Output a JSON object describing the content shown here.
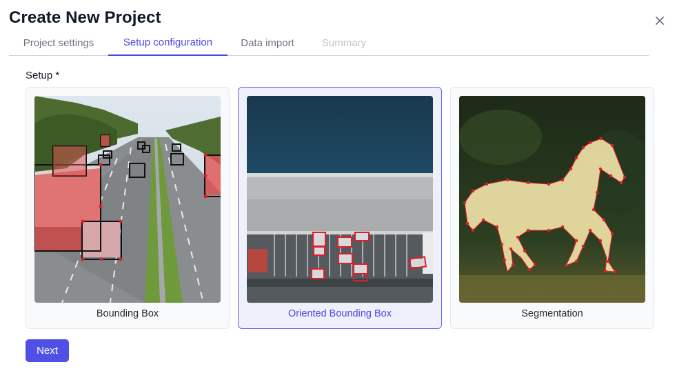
{
  "dialog": {
    "title": "Create New Project",
    "close_icon": "close-icon"
  },
  "tabs": [
    {
      "label": "Project settings",
      "state": "default"
    },
    {
      "label": "Setup configuration",
      "state": "active"
    },
    {
      "label": "Data import",
      "state": "default"
    },
    {
      "label": "Summary",
      "state": "disabled"
    }
  ],
  "setup": {
    "label": "Setup *",
    "options": [
      {
        "label": "Bounding Box",
        "image": "highway-trucks-bounding-box",
        "selected": false
      },
      {
        "label": "Oriented Bounding Box",
        "image": "aerial-parking-lot-oriented-boxes",
        "selected": true
      },
      {
        "label": "Segmentation",
        "image": "horse-polygon-segmentation",
        "selected": false
      }
    ]
  },
  "footer": {
    "next_label": "Next"
  },
  "colors": {
    "accent": "#4f46e5",
    "button": "#5150e6",
    "annotation": "#e11d2a"
  }
}
